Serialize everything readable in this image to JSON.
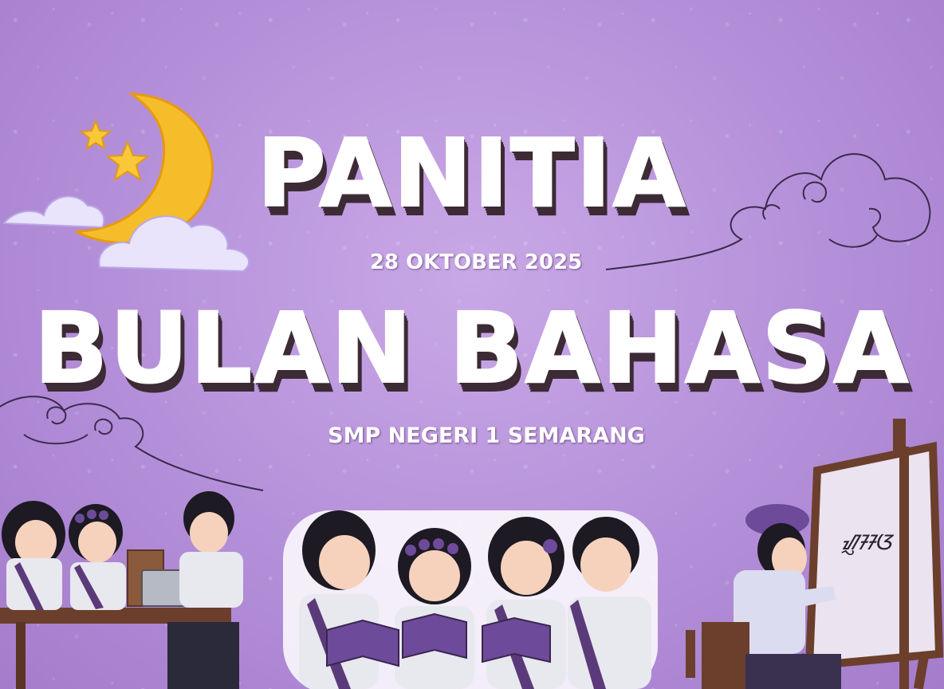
{
  "banner": {
    "title_line_1": "PANITIA",
    "date": "28 OKTOBER 2025",
    "title_line_2": "BULAN BAHASA",
    "school": "SMP NEGERI 1 SEMARANG",
    "canvas_writing": "ᮠᮢᮞᮃ"
  },
  "colors": {
    "background": "#b48fd9",
    "title_text": "#ffffff",
    "title_shadow": "#3c2a35",
    "moon": "#f6bd2b",
    "star": "#f8c83a",
    "cloud": "#e9e3fb",
    "uniform_shirt": "#e8e8ef",
    "sash": "#5b3a7a",
    "book": "#6d4a9a"
  },
  "icons": [
    "crescent-moon-icon",
    "star-icon",
    "cloud-icon",
    "swirl-cloud-icon",
    "easel-icon"
  ]
}
